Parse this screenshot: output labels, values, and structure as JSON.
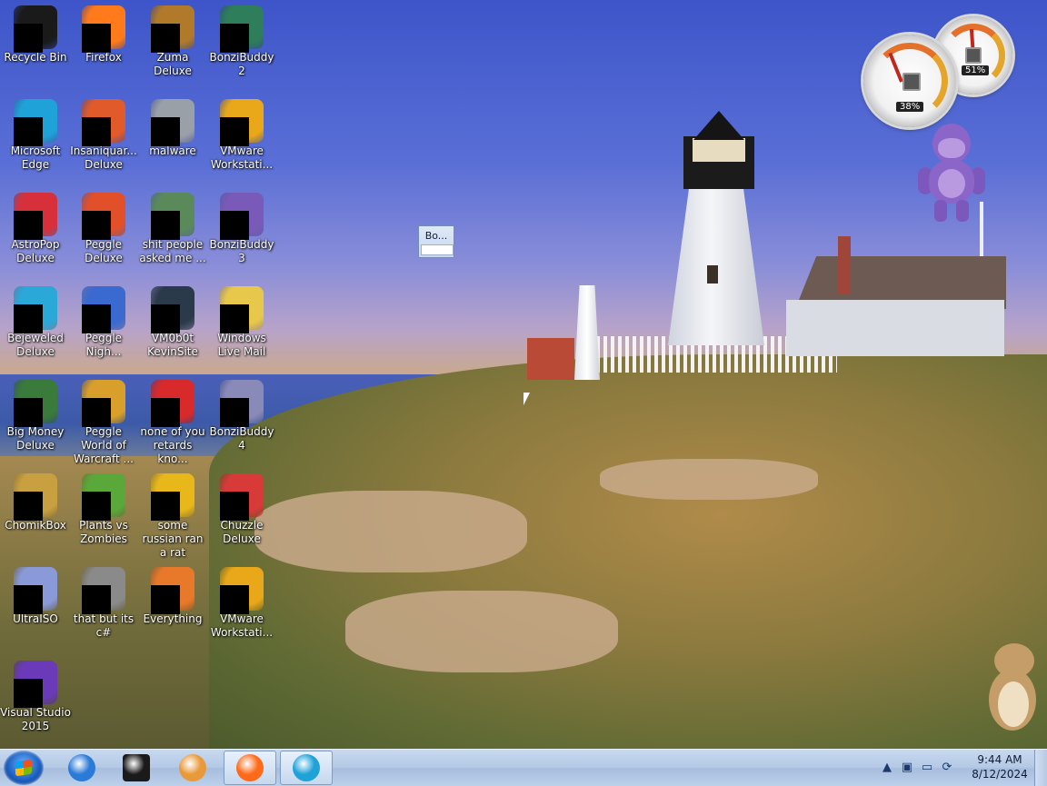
{
  "desktop": {
    "icons": [
      {
        "label": "Recycle Bin",
        "icon": "recycle-bin-icon",
        "color": "#1a1a1a"
      },
      {
        "label": "Firefox",
        "icon": "firefox-icon",
        "color": "#ff7a1a"
      },
      {
        "label": "Zuma Deluxe",
        "icon": "zuma-deluxe-icon",
        "color": "#b07a2a"
      },
      {
        "label": "BonziBuddy2",
        "icon": "bonzibuddy-icon",
        "color": "#2e7d5b"
      },
      {
        "label": "Microsoft Edge",
        "icon": "edge-icon",
        "color": "#1fa2d8"
      },
      {
        "label": "Insaniquar... Deluxe",
        "icon": "insaniquarium-icon",
        "color": "#e05a2a"
      },
      {
        "label": "malware",
        "icon": "folder-icon",
        "color": "#9aa0a8"
      },
      {
        "label": "VMware Workstati...",
        "icon": "vmware-icon",
        "color": "#e8a81a"
      },
      {
        "label": "AstroPop Deluxe",
        "icon": "astropop-icon",
        "color": "#d8303a"
      },
      {
        "label": "Peggle Deluxe",
        "icon": "peggle-icon",
        "color": "#e2502a"
      },
      {
        "label": "shit people asked me ...",
        "icon": "folder-icon",
        "color": "#5a8a5a"
      },
      {
        "label": "BonziBuddy3",
        "icon": "bonzibuddy-icon",
        "color": "#7a5ab8"
      },
      {
        "label": "Bejeweled Deluxe",
        "icon": "bejeweled-icon",
        "color": "#2aa8d8"
      },
      {
        "label": "Peggle Nigh...",
        "icon": "peggle-nights-icon",
        "color": "#3a6ad0"
      },
      {
        "label": "VM0b0t KevinSite",
        "icon": "monitor-icon",
        "color": "#2a3a4a"
      },
      {
        "label": "Windows Live Mail",
        "icon": "live-mail-icon",
        "color": "#e8c84a"
      },
      {
        "label": "Big Money Deluxe",
        "icon": "big-money-icon",
        "color": "#3a7a3a"
      },
      {
        "label": "Peggle World of Warcraft ...",
        "icon": "peggle-wow-icon",
        "color": "#d8a02a"
      },
      {
        "label": "none of you retards kno...",
        "icon": "opera-icon",
        "color": "#d82a2a"
      },
      {
        "label": "BonziBuddy4",
        "icon": "bonzibuddy-icon",
        "color": "#8a8ab8"
      },
      {
        "label": "ChomikBox",
        "icon": "chomikbox-icon",
        "color": "#c8a040"
      },
      {
        "label": "Plants vs Zombies",
        "icon": "plants-vs-zombies-icon",
        "color": "#5aa83a"
      },
      {
        "label": "some russian ran a rat",
        "icon": "java-icon",
        "color": "#e8b81a"
      },
      {
        "label": "Chuzzle Deluxe",
        "icon": "chuzzle-icon",
        "color": "#d83a3a"
      },
      {
        "label": "UltraISO",
        "icon": "ultraiso-icon",
        "color": "#8a9ad8"
      },
      {
        "label": "that but its c#",
        "icon": "copies-icon",
        "color": "#8a8a8a"
      },
      {
        "label": "Everything",
        "icon": "everything-icon",
        "color": "#e8782a"
      },
      {
        "label": "VMware Workstati...",
        "icon": "vmware-icon",
        "color": "#e8a81a"
      },
      {
        "label": "Visual Studio 2015",
        "icon": "visual-studio-icon",
        "color": "#6a3ab8"
      }
    ],
    "gadgets": {
      "cpu_meter_pct": "38%",
      "ram_meter_pct": "51%"
    },
    "mini_window": {
      "title": "Bo..."
    }
  },
  "taskbar": {
    "start_icon": "windows-start-icon",
    "pinned": [
      {
        "name": "internet-explorer",
        "icon": "internet-explorer-icon",
        "color": "#2a7ad8",
        "active": false
      },
      {
        "name": "bonzi-terminal",
        "icon": "black-box-icon",
        "color": "#1a1a1a",
        "active": false
      },
      {
        "name": "media-player",
        "icon": "media-player-icon",
        "color": "#e89a3a",
        "active": false
      },
      {
        "name": "firefox",
        "icon": "firefox-icon",
        "color": "#ff6a1a",
        "active": true
      },
      {
        "name": "edge",
        "icon": "edge-icon",
        "color": "#1fa2d8",
        "active": true
      }
    ],
    "tray": {
      "chevron": "▲",
      "icons": [
        "network-icon",
        "monitor-icon",
        "refresh-icon"
      ]
    },
    "clock": {
      "time": "9:44 AM",
      "date": "8/12/2024"
    }
  }
}
